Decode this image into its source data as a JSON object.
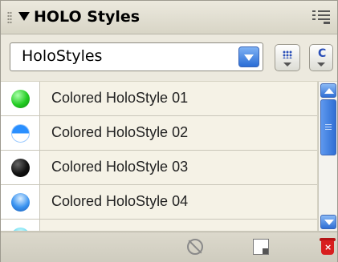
{
  "panel": {
    "title": "HOLO Styles",
    "selector": {
      "value": "HoloStyles"
    },
    "styles": [
      {
        "label": "Colored HoloStyle 01",
        "swatch_color": "#22cc22"
      },
      {
        "label": "Colored HoloStyle 02",
        "swatch_color": "#2a8fff"
      },
      {
        "label": "Colored HoloStyle 03",
        "swatch_color": "#111111"
      },
      {
        "label": "Colored HoloStyle 04",
        "swatch_color": "#3a93f0"
      }
    ],
    "icons": {
      "collapse": "triangle-down-icon",
      "panel_menu": "list-menu-icon",
      "grid_view": "grid-icon",
      "c_button": "c-icon",
      "clear": "no-entry-icon",
      "new_style": "new-page-icon",
      "delete": "trash-icon"
    },
    "colors": {
      "accent": "#2f6fd4",
      "panel_bg": "#d6d3c4"
    }
  }
}
